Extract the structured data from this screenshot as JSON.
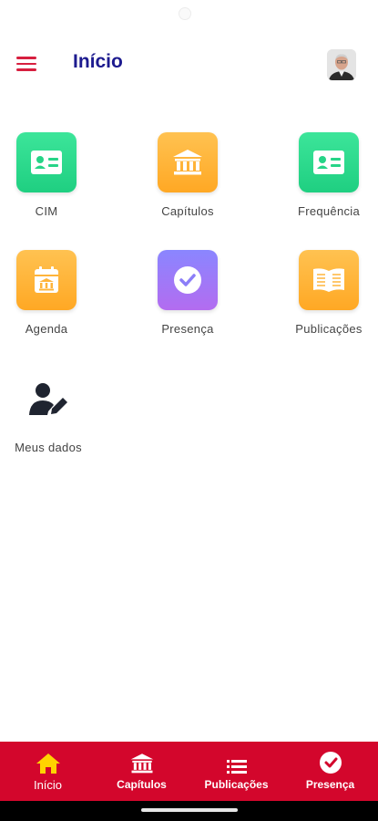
{
  "header": {
    "title": "Início"
  },
  "tiles": [
    {
      "label": "CIM",
      "icon": "id-card-icon",
      "color": "#2bdc8d"
    },
    {
      "label": "Capítulos",
      "icon": "institution-icon",
      "color": "#ffb43a"
    },
    {
      "label": "Frequência",
      "icon": "id-card-icon",
      "color": "#2bdc8d"
    },
    {
      "label": "Agenda",
      "icon": "calendar-icon",
      "color": "#ffb43a"
    },
    {
      "label": "Presença",
      "icon": "check-circle-icon",
      "color": "#9a7cf8"
    },
    {
      "label": "Publicações",
      "icon": "open-book-icon",
      "color": "#ffb43a"
    },
    {
      "label": "Meus dados",
      "icon": "user-edit-icon",
      "color": "#1f2430"
    }
  ],
  "bottom_nav": [
    {
      "label": "Início",
      "icon": "home-icon",
      "active": true
    },
    {
      "label": "Capítulos",
      "icon": "institution-icon"
    },
    {
      "label": "Publicações",
      "icon": "list-icon"
    },
    {
      "label": "Presença",
      "icon": "check-circle-icon"
    }
  ],
  "colors": {
    "brand_red": "#d3062c",
    "title_blue": "#1d1b8f",
    "active_icon": "#ffd400"
  }
}
